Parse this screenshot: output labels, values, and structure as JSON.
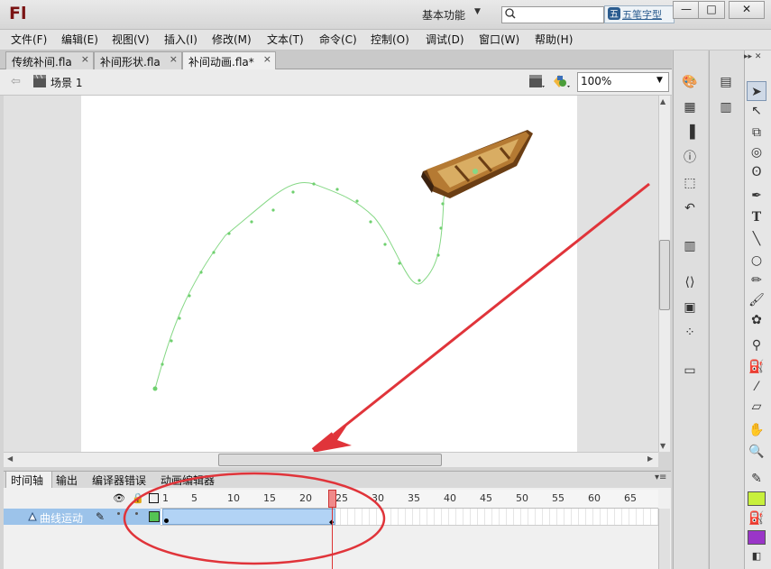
{
  "app": {
    "logo": "Fl",
    "workspace": "基本功能",
    "ime_label": "五笔字型"
  },
  "window": {
    "minimize": "—",
    "maximize": "□",
    "close": "✕"
  },
  "menu": [
    "文件(F)",
    "编辑(E)",
    "视图(V)",
    "插入(I)",
    "修改(M)",
    "文本(T)",
    "命令(C)",
    "控制(O)",
    "调试(D)",
    "窗口(W)",
    "帮助(H)"
  ],
  "doc_tabs": [
    {
      "label": "传统补间.fla",
      "active": false
    },
    {
      "label": "补间形状.fla",
      "active": false
    },
    {
      "label": "补间动画.fla*",
      "active": true
    }
  ],
  "tab_close": "×",
  "scene": {
    "label": "场景 1"
  },
  "zoom": {
    "value": "100%"
  },
  "timeline": {
    "tabs": [
      "时间轴",
      "输出",
      "编译器错误",
      "动画编辑器"
    ],
    "ruler": [
      1,
      5,
      10,
      15,
      20,
      25,
      30,
      35,
      40,
      45,
      50,
      55,
      60,
      65
    ],
    "current_frame": 24,
    "tween_end_frame": 24,
    "layer": {
      "name": "曲线运动"
    }
  },
  "colors": {
    "accent": "#9cc3ea",
    "motion_path": "#86d886",
    "annotation_red": "#e0343a",
    "stroke_swatch": "#c8f03c",
    "fill_swatch": "#9a35c8",
    "keyframe_swatch": "#54c454"
  },
  "icons": {
    "tools": [
      "selection-tool-icon",
      "subselection-tool-icon",
      "free-transform-tool-icon",
      "3d-rotation-tool-icon",
      "lasso-tool-icon",
      "pen-tool-icon",
      "text-tool-icon",
      "line-tool-icon",
      "oval-tool-icon",
      "pencil-tool-icon",
      "brush-tool-icon",
      "deco-tool-icon",
      "bone-tool-icon",
      "paint-bucket-tool-icon",
      "eyedropper-tool-icon",
      "eraser-tool-icon",
      "hand-tool-icon",
      "zoom-tool-icon"
    ]
  }
}
